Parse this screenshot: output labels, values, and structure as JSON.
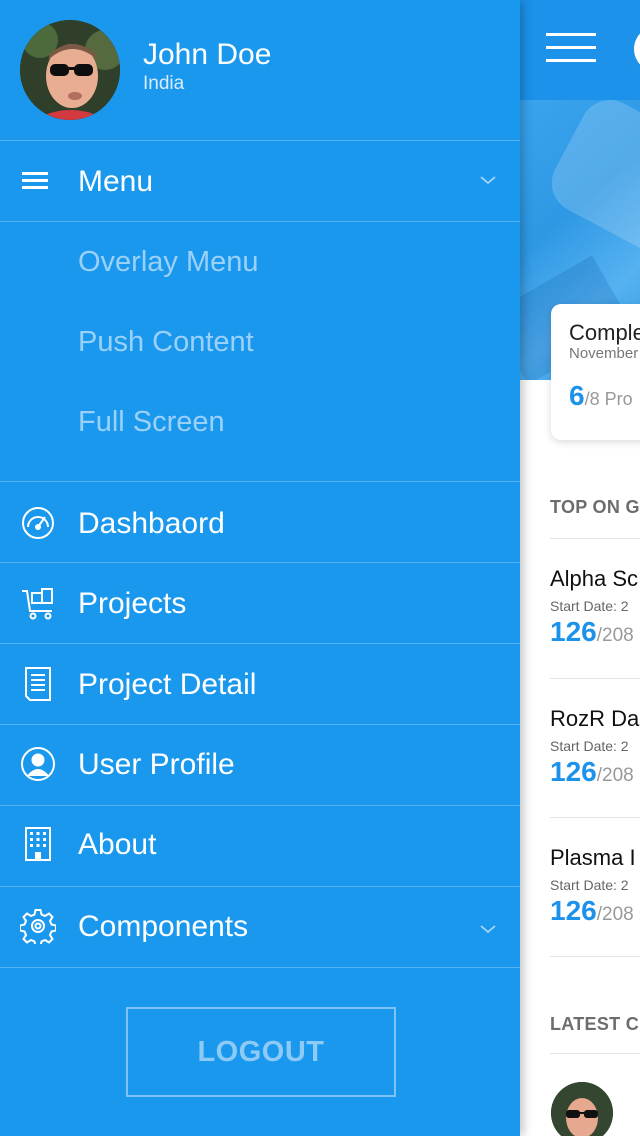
{
  "drawer": {
    "user": {
      "name": "John Doe",
      "country": "India"
    },
    "menu": {
      "label": "Menu",
      "icon": "menu-icon",
      "expanded": true,
      "sub_items": [
        {
          "label": "Overlay Menu"
        },
        {
          "label": "Push Content"
        },
        {
          "label": "Full Screen"
        }
      ]
    },
    "items": [
      {
        "label": "Dashbaord",
        "icon": "dashboard-gauge-icon"
      },
      {
        "label": "Projects",
        "icon": "cart-icon"
      },
      {
        "label": "Project Detail",
        "icon": "document-icon"
      },
      {
        "label": "User Profile",
        "icon": "user-icon"
      },
      {
        "label": "About",
        "icon": "building-icon"
      },
      {
        "label": "Components",
        "icon": "gear-icon"
      }
    ],
    "logout_label": "LOGOUT",
    "colors": {
      "background": "#1a98ee",
      "sub_item_text": "#9bd1f8"
    }
  },
  "page": {
    "completed_card": {
      "title": "Comple",
      "date": "November",
      "count": "6",
      "total": "/8 Pro"
    },
    "top_section_title": "TOP ON G",
    "projects": [
      {
        "name": "Alpha Sc",
        "start": "Start Date: 2",
        "count": "126",
        "total": "/208"
      },
      {
        "name": "RozR Da",
        "start": "Start Date: 2",
        "count": "126",
        "total": "/208"
      },
      {
        "name": "Plasma I",
        "start": "Start Date: 2",
        "count": "126",
        "total": "/208"
      }
    ],
    "latest_section_title": "LATEST C",
    "colors": {
      "accent": "#1c92ea"
    }
  }
}
